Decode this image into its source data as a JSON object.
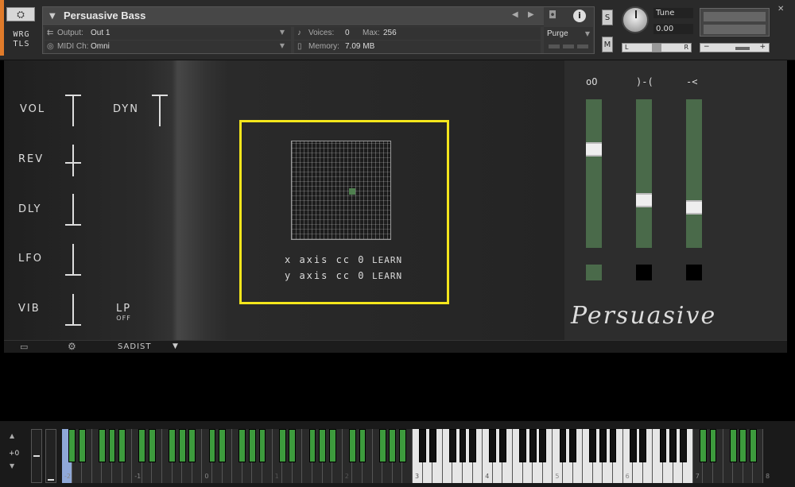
{
  "header": {
    "logo_icon": "⛭",
    "logo_text_line1": "WRG",
    "logo_text_line2": "TLS",
    "instrument_name": "Persuasive Bass",
    "output_label": "Output:",
    "output_value": "Out 1",
    "midi_label": "MIDI Ch:",
    "midi_value": "Omni",
    "voices_label": "Voices:",
    "voices_value": "0",
    "max_label": "Max:",
    "max_value": "256",
    "memory_label": "Memory:",
    "memory_value": "7.09 MB",
    "purge_label": "Purge",
    "solo_label": "S",
    "mute_label": "M",
    "tune_label": "Tune",
    "tune_value": "0.00",
    "pan_left": "L",
    "pan_right": "R",
    "vol_minus": "−",
    "vol_plus": "+",
    "close_icon": "✕",
    "info_icon": "i"
  },
  "fx_controls": {
    "vol": "VOL",
    "dyn": "DYN",
    "rev": "REV",
    "dly": "DLY",
    "lfo": "LFO",
    "vib": "VIB",
    "lp": "LP",
    "lp_state": "OFF"
  },
  "xy_pad": {
    "x_row": "x axis cc 0",
    "y_row": "y axis cc 0",
    "learn": "LEARN",
    "x_value": 0.6,
    "y_value": 0.5
  },
  "mixer": {
    "labels": [
      "oO",
      ")-(",
      "-<"
    ],
    "levels": [
      0.68,
      0.3,
      0.25
    ],
    "track_color": "#4a6a4a",
    "button_states": [
      "green",
      "black",
      "black"
    ]
  },
  "brand": "Persuasive",
  "bottom_bar": {
    "preset": "SADIST",
    "preset_arrow": "▼"
  },
  "keyboard": {
    "octave_label": "+0",
    "key_numbers": [
      "-2",
      "-1",
      "0",
      "1",
      "2",
      "3",
      "4",
      "5",
      "6",
      "7",
      "8"
    ],
    "accent": "#3d9b3d"
  }
}
